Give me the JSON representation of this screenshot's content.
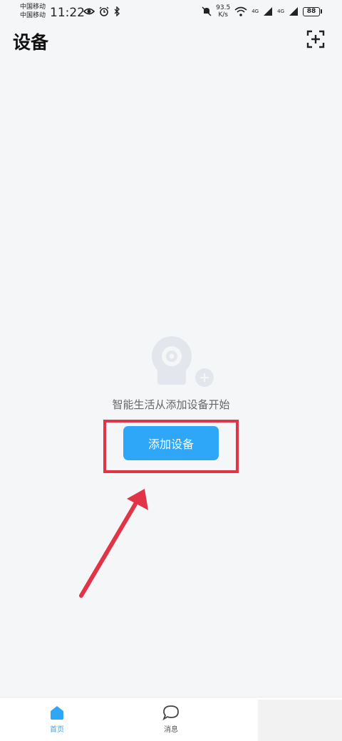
{
  "status": {
    "carrier1": "中国移动",
    "carrier2": "中国移动",
    "time": "11:22",
    "net_speed_value": "93.5",
    "net_speed_unit": "K/s",
    "signal1_label": "4G",
    "signal2_label": "4G",
    "battery": "88"
  },
  "header": {
    "title": "设备"
  },
  "empty_state": {
    "message": "智能生活从添加设备开始",
    "add_button_label": "添加设备"
  },
  "nav": {
    "items": [
      {
        "label": "首页",
        "icon": "home-icon",
        "active": true
      },
      {
        "label": "消息",
        "icon": "message-icon",
        "active": false
      }
    ]
  },
  "colors": {
    "accent": "#2ea7f8",
    "highlight": "#e23447",
    "background": "#f5f6f8"
  }
}
